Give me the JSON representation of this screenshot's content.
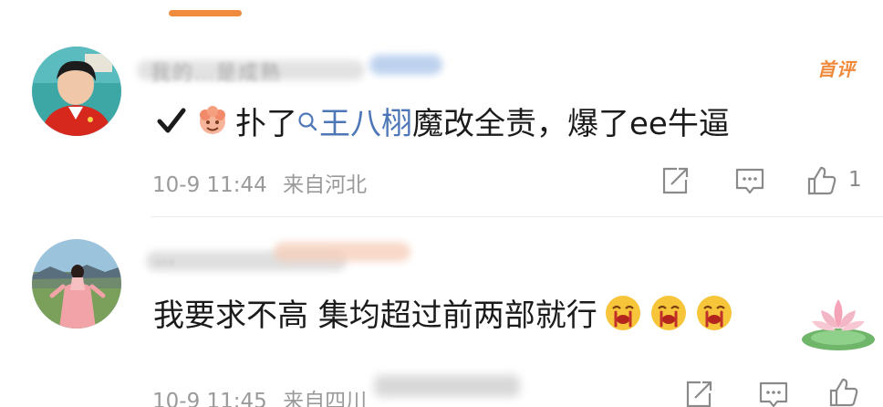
{
  "comments": [
    {
      "username": "我的…是成熟",
      "badge": "首评",
      "text_prefix": "扑了",
      "topic": "王八栩",
      "text_suffix": "魔改全责，爆了ee牛逼",
      "date": "10-9 11:44",
      "location": "来自河北",
      "like_count": "1",
      "icons": [
        "check-icon",
        "emoji-sticker-icon",
        "search-icon",
        "share-icon",
        "comment-icon",
        "like-icon"
      ]
    },
    {
      "username": "…",
      "text": "我要求不高 集均超过前两部就行",
      "date": "10-9 11:45",
      "location": "来自四川",
      "icons": [
        "cry-emoji-icon",
        "lotus-icon",
        "share-icon",
        "comment-icon",
        "like-icon"
      ]
    }
  ],
  "colors": {
    "accent": "#f08a3c",
    "topic_link": "#4e77b8",
    "meta_text": "#9a9a9a",
    "body_text": "#1b1b1b"
  }
}
